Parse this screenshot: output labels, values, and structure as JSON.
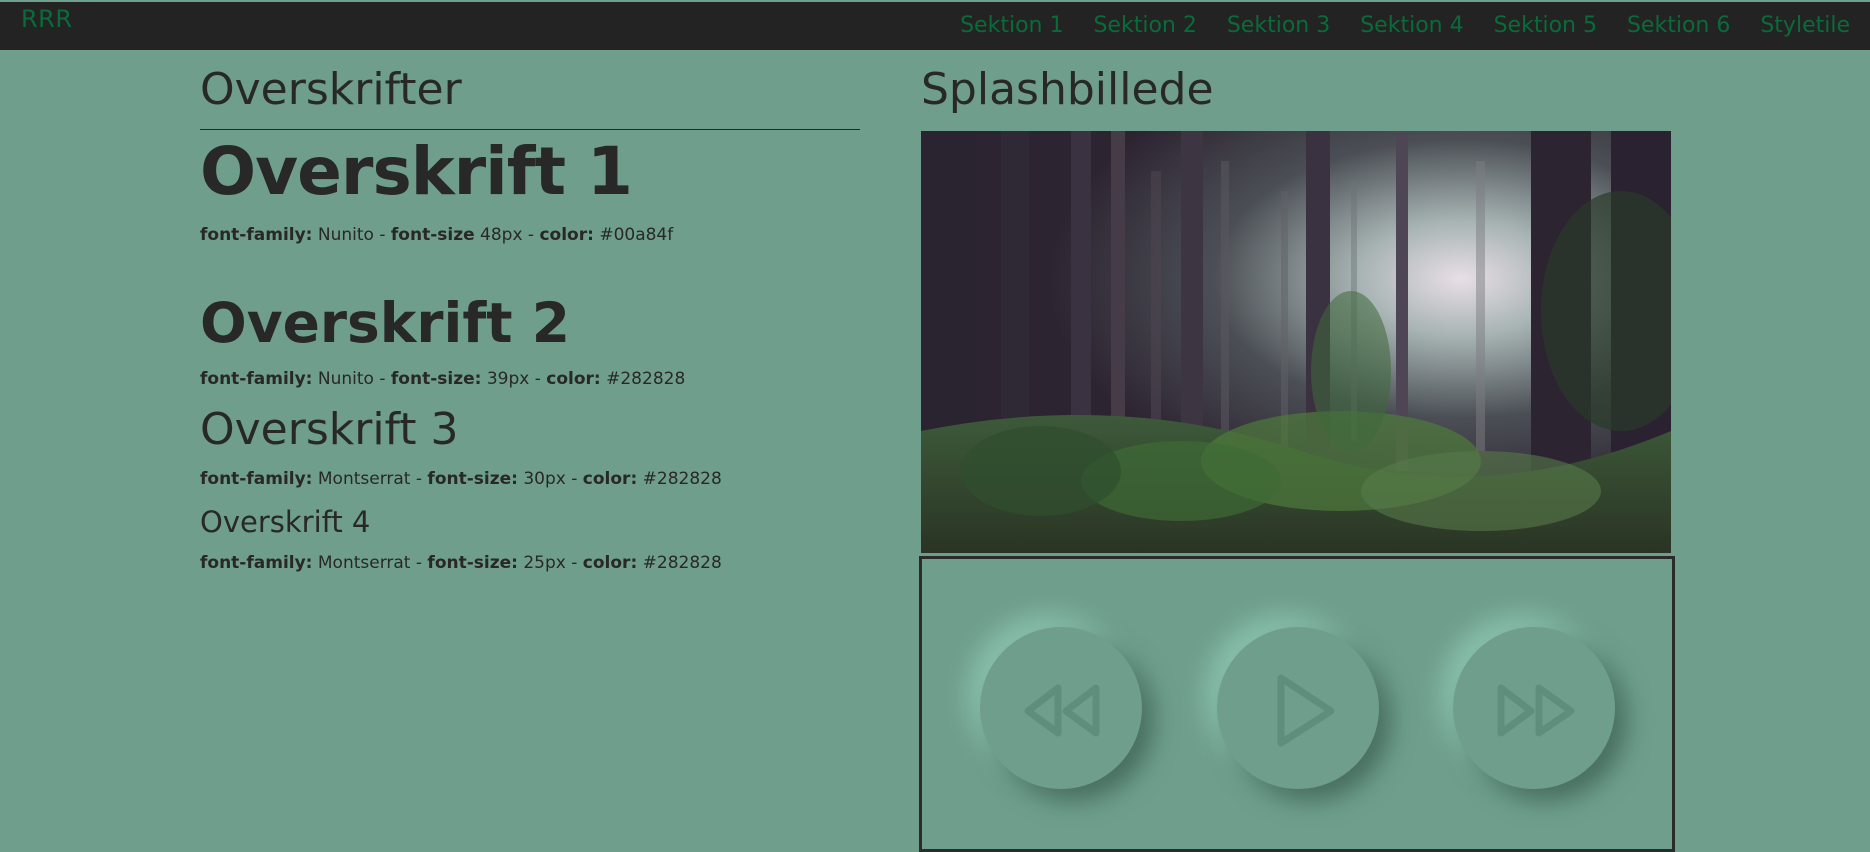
{
  "header": {
    "brand": "RRR",
    "nav": [
      "Sektion 1",
      "Sektion 2",
      "Sektion 3",
      "Sektion 4",
      "Sektion 5",
      "Sektion 6",
      "Styletile"
    ]
  },
  "headings_section": {
    "title": "Overskrifter",
    "items": [
      {
        "text": "Overskrift 1",
        "specs": [
          {
            "label": "font-family:",
            "value": " Nunito - "
          },
          {
            "label": "font-size",
            "value": " 48px - "
          },
          {
            "label": "color:",
            "value": " #00a84f"
          }
        ]
      },
      {
        "text": "Overskrift 2",
        "specs": [
          {
            "label": "font-family:",
            "value": " Nunito - "
          },
          {
            "label": "font-size:",
            "value": " 39px - "
          },
          {
            "label": "color:",
            "value": " #282828"
          }
        ]
      },
      {
        "text": "Overskrift 3",
        "specs": [
          {
            "label": "font-family:",
            "value": " Montserrat - "
          },
          {
            "label": "font-size:",
            "value": " 30px - "
          },
          {
            "label": "color:",
            "value": " #282828"
          }
        ]
      },
      {
        "text": "Overskrift 4",
        "specs": [
          {
            "label": "font-family:",
            "value": " Montserrat - "
          },
          {
            "label": "font-size:",
            "value": " 25px - "
          },
          {
            "label": "color:",
            "value": " #282828"
          }
        ]
      }
    ]
  },
  "splash_section": {
    "title": "Splashbillede"
  },
  "player": {
    "buttons": [
      "rewind-icon",
      "play-icon",
      "fast-forward-icon"
    ]
  },
  "colors": {
    "background": "#6f9f8c",
    "topbar": "#232323",
    "nav_text": "#0a6b3a",
    "text": "#282828"
  }
}
